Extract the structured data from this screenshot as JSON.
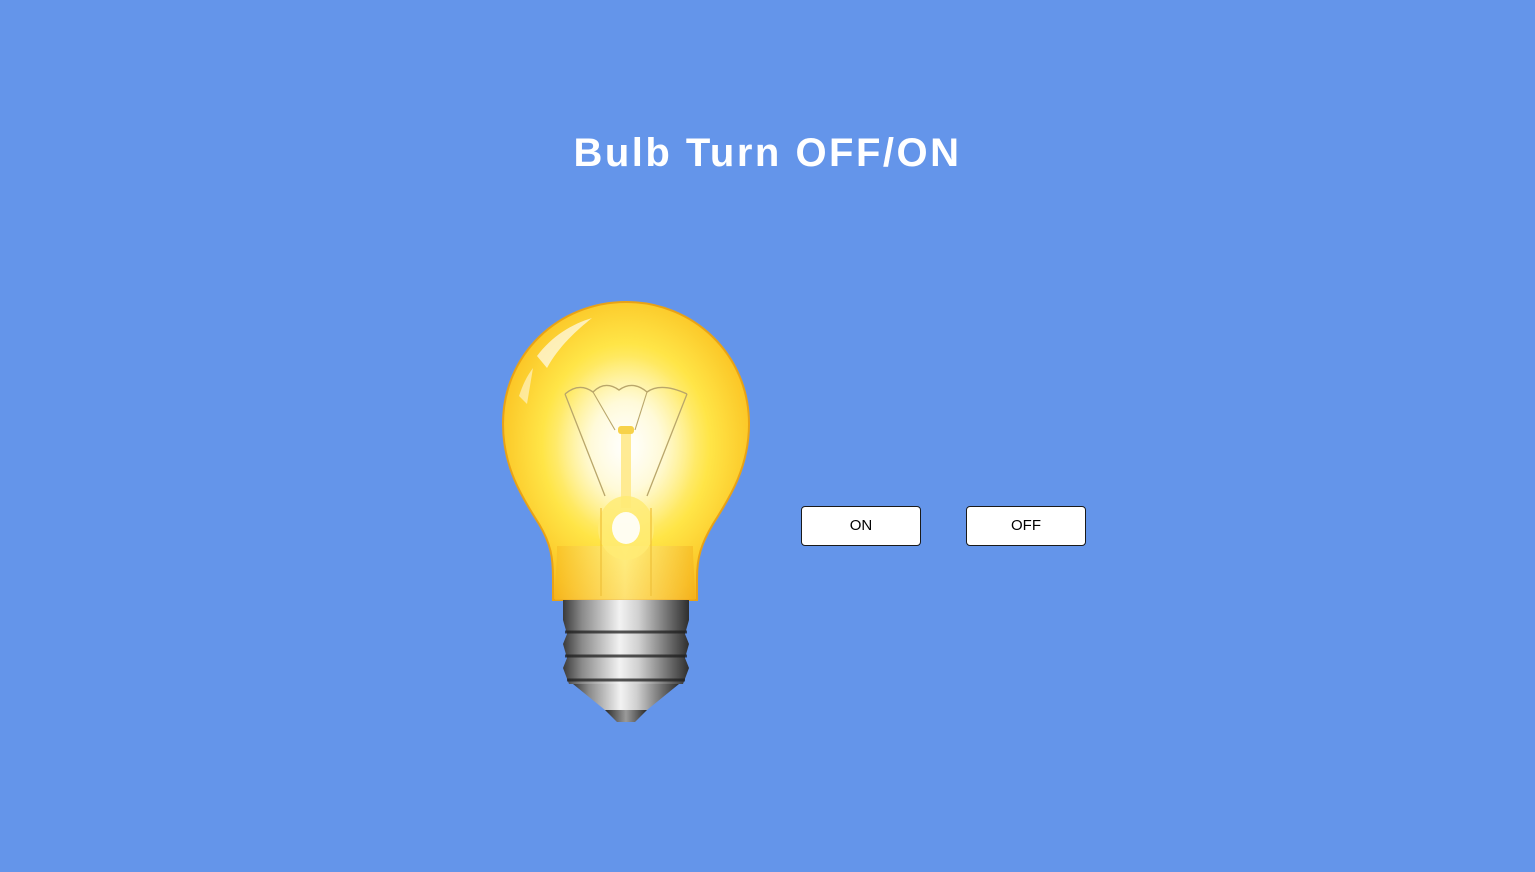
{
  "page": {
    "title": "Bulb Turn OFF/ON",
    "background_color": "#6495ea"
  },
  "bulb": {
    "icon": "light-bulb-icon",
    "state": "on",
    "glass_color": "#ffd52a",
    "base_color": "#9a9a9a"
  },
  "controls": {
    "on_label": "ON",
    "off_label": "OFF"
  }
}
